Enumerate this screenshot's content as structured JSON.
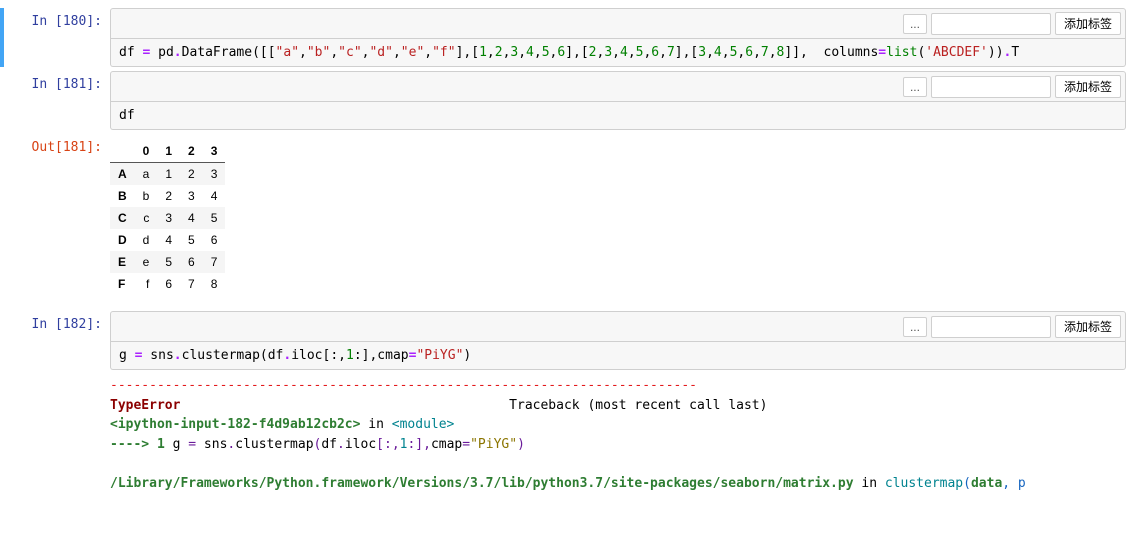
{
  "toolbar": {
    "ellipsis_label": "...",
    "add_tag_label": "添加标签",
    "tag_placeholder": ""
  },
  "cells": {
    "c180": {
      "prompt": "In [180]:",
      "code_tokens": [
        {
          "t": "df ",
          "c": "tk-name"
        },
        {
          "t": "=",
          "c": "tk-op"
        },
        {
          "t": " pd",
          "c": "tk-name"
        },
        {
          "t": ".",
          "c": "tk-op"
        },
        {
          "t": "DataFrame([[",
          "c": "tk-name"
        },
        {
          "t": "\"a\"",
          "c": "tk-str"
        },
        {
          "t": ",",
          "c": "tk-name"
        },
        {
          "t": "\"b\"",
          "c": "tk-str"
        },
        {
          "t": ",",
          "c": "tk-name"
        },
        {
          "t": "\"c\"",
          "c": "tk-str"
        },
        {
          "t": ",",
          "c": "tk-name"
        },
        {
          "t": "\"d\"",
          "c": "tk-str"
        },
        {
          "t": ",",
          "c": "tk-name"
        },
        {
          "t": "\"e\"",
          "c": "tk-str"
        },
        {
          "t": ",",
          "c": "tk-name"
        },
        {
          "t": "\"f\"",
          "c": "tk-str"
        },
        {
          "t": "],[",
          "c": "tk-name"
        },
        {
          "t": "1",
          "c": "tk-num"
        },
        {
          "t": ",",
          "c": "tk-name"
        },
        {
          "t": "2",
          "c": "tk-num"
        },
        {
          "t": ",",
          "c": "tk-name"
        },
        {
          "t": "3",
          "c": "tk-num"
        },
        {
          "t": ",",
          "c": "tk-name"
        },
        {
          "t": "4",
          "c": "tk-num"
        },
        {
          "t": ",",
          "c": "tk-name"
        },
        {
          "t": "5",
          "c": "tk-num"
        },
        {
          "t": ",",
          "c": "tk-name"
        },
        {
          "t": "6",
          "c": "tk-num"
        },
        {
          "t": "],[",
          "c": "tk-name"
        },
        {
          "t": "2",
          "c": "tk-num"
        },
        {
          "t": ",",
          "c": "tk-name"
        },
        {
          "t": "3",
          "c": "tk-num"
        },
        {
          "t": ",",
          "c": "tk-name"
        },
        {
          "t": "4",
          "c": "tk-num"
        },
        {
          "t": ",",
          "c": "tk-name"
        },
        {
          "t": "5",
          "c": "tk-num"
        },
        {
          "t": ",",
          "c": "tk-name"
        },
        {
          "t": "6",
          "c": "tk-num"
        },
        {
          "t": ",",
          "c": "tk-name"
        },
        {
          "t": "7",
          "c": "tk-num"
        },
        {
          "t": "],[",
          "c": "tk-name"
        },
        {
          "t": "3",
          "c": "tk-num"
        },
        {
          "t": ",",
          "c": "tk-name"
        },
        {
          "t": "4",
          "c": "tk-num"
        },
        {
          "t": ",",
          "c": "tk-name"
        },
        {
          "t": "5",
          "c": "tk-num"
        },
        {
          "t": ",",
          "c": "tk-name"
        },
        {
          "t": "6",
          "c": "tk-num"
        },
        {
          "t": ",",
          "c": "tk-name"
        },
        {
          "t": "7",
          "c": "tk-num"
        },
        {
          "t": ",",
          "c": "tk-name"
        },
        {
          "t": "8",
          "c": "tk-num"
        },
        {
          "t": "]],  columns",
          "c": "tk-name"
        },
        {
          "t": "=",
          "c": "tk-op"
        },
        {
          "t": "list",
          "c": "tk-builtin"
        },
        {
          "t": "(",
          "c": "tk-name"
        },
        {
          "t": "'ABCDEF'",
          "c": "tk-str"
        },
        {
          "t": "))",
          "c": "tk-name"
        },
        {
          "t": ".",
          "c": "tk-op"
        },
        {
          "t": "T",
          "c": "tk-name"
        }
      ]
    },
    "c181": {
      "prompt": "In [181]:",
      "out_prompt": "Out[181]:",
      "code_tokens": [
        {
          "t": "df",
          "c": "tk-name"
        }
      ],
      "df": {
        "cols": [
          "0",
          "1",
          "2",
          "3"
        ],
        "rows": [
          {
            "idx": "A",
            "vals": [
              "a",
              "1",
              "2",
              "3"
            ]
          },
          {
            "idx": "B",
            "vals": [
              "b",
              "2",
              "3",
              "4"
            ]
          },
          {
            "idx": "C",
            "vals": [
              "c",
              "3",
              "4",
              "5"
            ]
          },
          {
            "idx": "D",
            "vals": [
              "d",
              "4",
              "5",
              "6"
            ]
          },
          {
            "idx": "E",
            "vals": [
              "e",
              "5",
              "6",
              "7"
            ]
          },
          {
            "idx": "F",
            "vals": [
              "f",
              "6",
              "7",
              "8"
            ]
          }
        ]
      }
    },
    "c182": {
      "prompt": "In [182]:",
      "code_tokens": [
        {
          "t": "g ",
          "c": "tk-name"
        },
        {
          "t": "=",
          "c": "tk-op"
        },
        {
          "t": " sns",
          "c": "tk-name"
        },
        {
          "t": ".",
          "c": "tk-op"
        },
        {
          "t": "clustermap(df",
          "c": "tk-name"
        },
        {
          "t": ".",
          "c": "tk-op"
        },
        {
          "t": "iloc[:,",
          "c": "tk-name"
        },
        {
          "t": "1",
          "c": "tk-num"
        },
        {
          "t": ":],cmap",
          "c": "tk-name"
        },
        {
          "t": "=",
          "c": "tk-op"
        },
        {
          "t": "\"PiYG\"",
          "c": "tk-str"
        },
        {
          "t": ")",
          "c": "tk-name"
        }
      ],
      "traceback": {
        "sep": "---------------------------------------------------------------------------",
        "exc_name": "TypeError",
        "exc_msg_head": "                                          Traceback (most recent call last)",
        "line1_a": "<ipython-input-182-f4d9ab12cb2c>",
        "line1_b": " in ",
        "line1_c": "<module>",
        "line2_arrow": "----> 1",
        "line2_code_pre": " g ",
        "line2_eq": "=",
        "line2_code_post": " sns",
        "line2_dot1": ".",
        "line2_clustermap": "clustermap",
        "line2_paren_open": "(",
        "line2_df": "df",
        "line2_dot2": ".",
        "line2_iloc": "iloc",
        "line2_br_open": "[",
        "line2_colon1": ":",
        "line2_comma": ",",
        "line2_one": "1",
        "line2_colon2": ":",
        "line2_br_close": "]",
        "line2_comma2": ",",
        "line2_cmap": "cmap",
        "line2_eq2": "=",
        "line2_str": "\"PiYG\"",
        "line2_paren_close": ")",
        "line3_path": "/Library/Frameworks/Python.framework/Versions/3.7/lib/python3.7/site-packages/seaborn/matrix.py",
        "line3_in": " in ",
        "line3_fn": "clustermap",
        "line3_args_open": "(",
        "line3_arg_data": "data",
        "line3_args_rest": ", p"
      }
    }
  }
}
